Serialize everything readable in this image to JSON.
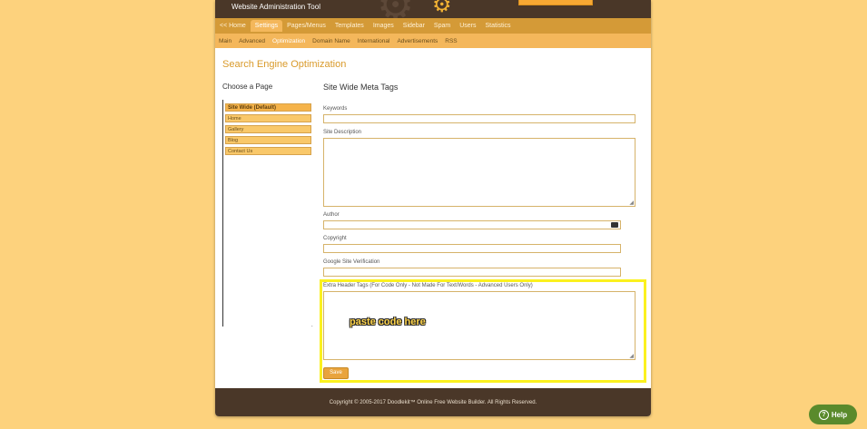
{
  "app": {
    "title": "Website Administration Tool"
  },
  "main_nav": [
    {
      "label": "<< Home",
      "active": false
    },
    {
      "label": "Settings",
      "active": true
    },
    {
      "label": "Pages/Menus",
      "active": false
    },
    {
      "label": "Templates",
      "active": false
    },
    {
      "label": "Images",
      "active": false
    },
    {
      "label": "Sidebar",
      "active": false
    },
    {
      "label": "Spam",
      "active": false
    },
    {
      "label": "Users",
      "active": false
    },
    {
      "label": "Statistics",
      "active": false
    }
  ],
  "sub_nav": [
    {
      "label": "Main",
      "active": false
    },
    {
      "label": "Advanced",
      "active": false
    },
    {
      "label": "Optimization",
      "active": true
    },
    {
      "label": "Domain Name",
      "active": false
    },
    {
      "label": "International",
      "active": false
    },
    {
      "label": "Advertisements",
      "active": false
    },
    {
      "label": "RSS",
      "active": false
    }
  ],
  "page_title": "Search Engine Optimization",
  "sidebar": {
    "label": "Choose a Page",
    "pages": [
      {
        "label": "Site Wide (Default)",
        "active": true
      },
      {
        "label": "Home",
        "active": false
      },
      {
        "label": "Gallery",
        "active": false
      },
      {
        "label": "Blog",
        "active": false
      },
      {
        "label": "Contact Us",
        "active": false
      }
    ]
  },
  "content": {
    "title": "Site Wide Meta Tags",
    "keywords_label": "Keywords",
    "description_label": "Site Description",
    "author_label": "Author",
    "copyright_label": "Copyright",
    "google_label": "Google Site Verification",
    "extra_label": "Extra Header Tags (For Code Only - Not Made For Text/Words - Advanced Users Only)",
    "annotation": "paste code here",
    "save_label": "Save"
  },
  "footer": {
    "text": "Copyright © 2005-2017 Doodlekit™ Online Free Website Builder. All Rights Reserved."
  },
  "help": {
    "label": "Help",
    "icon": "?"
  },
  "colors": {
    "background": "#fdd27d",
    "header": "#4a3728",
    "nav": "#d49a37",
    "subnav": "#f4b75b",
    "accent": "#d99a2a",
    "highlight": "#fbf11f",
    "help": "#5a8a2c"
  }
}
